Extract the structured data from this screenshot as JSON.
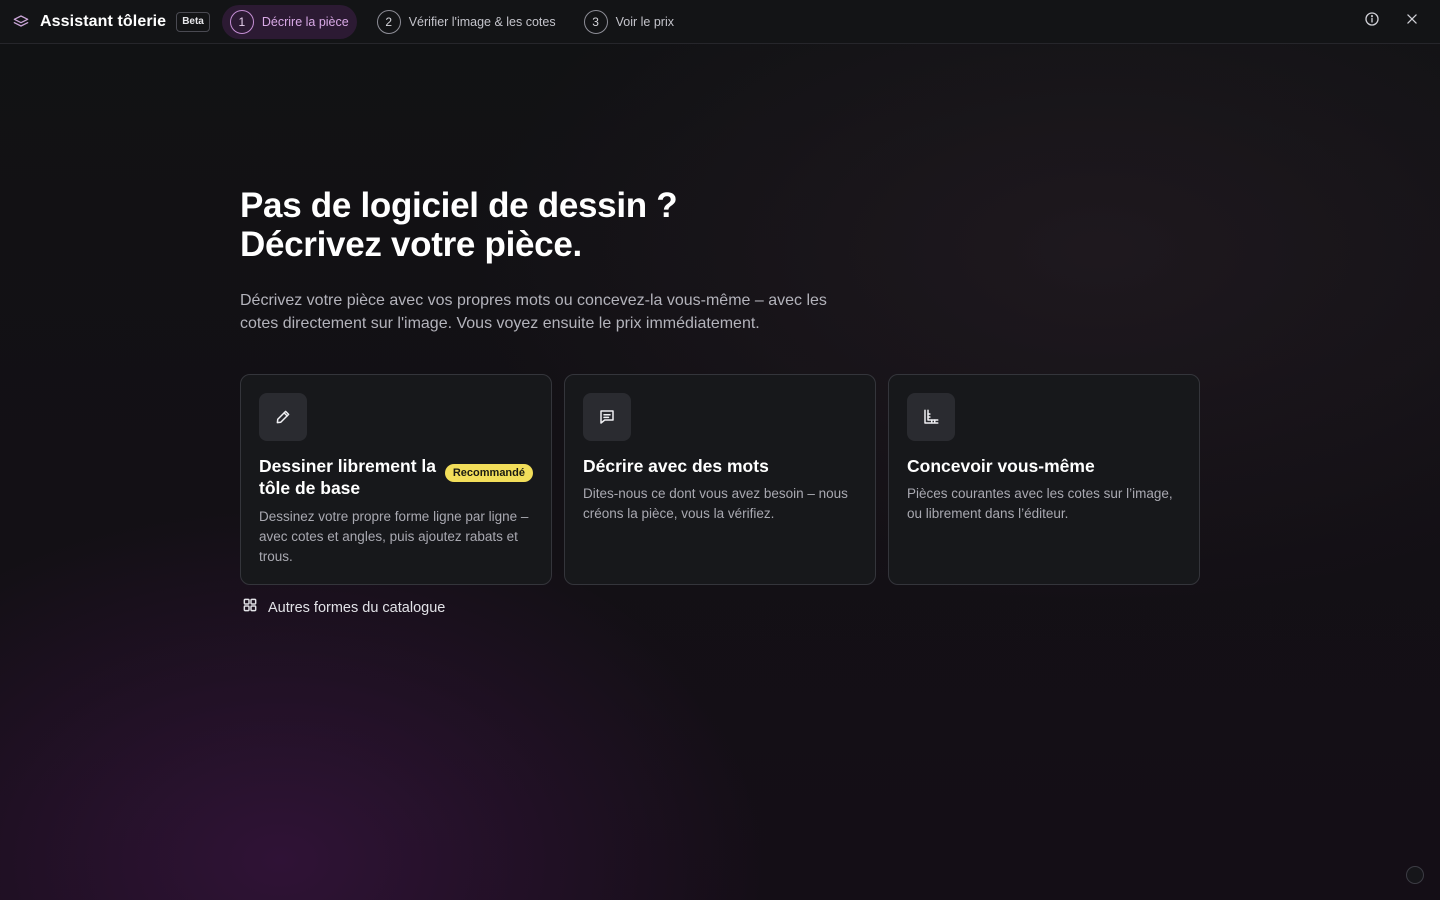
{
  "header": {
    "title": "Assistant tôlerie",
    "badge": "Beta",
    "steps": [
      {
        "number": "1",
        "label": "Décrire la pièce",
        "active": true
      },
      {
        "number": "2",
        "label": "Vérifier l'image & les cotes",
        "active": false
      },
      {
        "number": "3",
        "label": "Voir le prix",
        "active": false
      }
    ],
    "icons": {
      "brand": "layers-icon",
      "info": "info-icon",
      "close": "close-icon"
    }
  },
  "hero": {
    "title_line1": "Pas de logiciel de dessin ?",
    "title_line2": "Décrivez votre pièce.",
    "subtitle": "Décrivez votre pièce avec vos propres mots ou concevez-la vous-même – avec les cotes directement sur l'image. Vous voyez ensuite le prix immédiatement."
  },
  "cards": [
    {
      "icon": "pencil-icon",
      "title": "Dessiner librement la tôle de base",
      "badge": "Recommandé",
      "description": "Dessinez votre propre forme ligne par ligne – avec cotes et angles, puis ajoutez rabats et trous."
    },
    {
      "icon": "message-icon",
      "title": "Décrire avec des mots",
      "description": "Dites-nous ce dont vous avez besoin – nous créons la pièce, vous la vérifiez."
    },
    {
      "icon": "ruler-corner-icon",
      "title": "Concevoir vous-même",
      "description": "Pièces courantes avec les cotes sur l’image, ou librement dans l’éditeur."
    }
  ],
  "catalog": {
    "icon": "grid-icon",
    "label": "Autres formes du catalogue"
  },
  "colors": {
    "accent": "#d9a9e6",
    "active_step_bg": "#2c1a33",
    "badge_bg": "#f2de5a",
    "card_bg": "#17181b"
  }
}
